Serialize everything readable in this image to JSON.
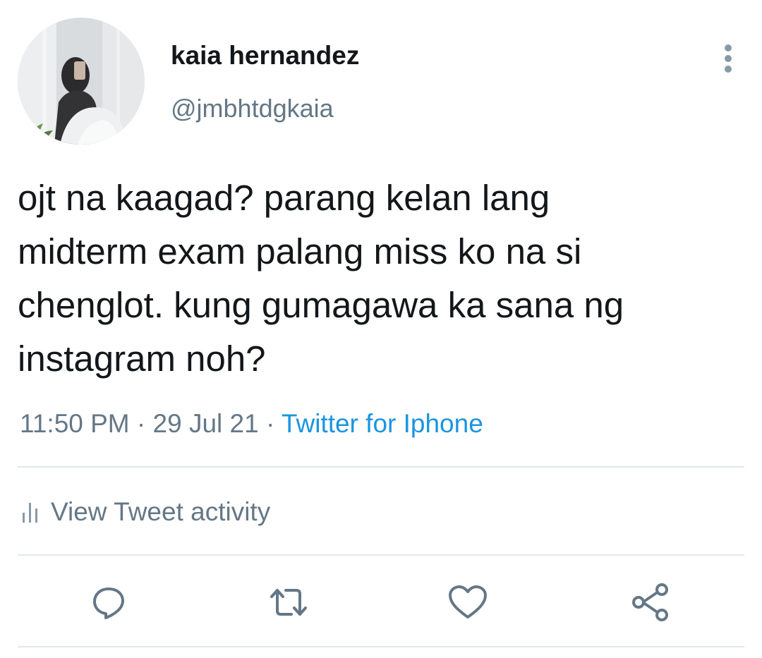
{
  "user": {
    "display_name": "kaia hernandez",
    "handle": "@jmbhtdgkaia",
    "avatar_icon": "profile-photo"
  },
  "tweet": {
    "text": "ojt na kaagad? parang kelan lang\nmidterm exam palang miss ko na si\nchenglot. kung gumagawa ka sana ng\ninstagram noh?",
    "time": "11:50 PM",
    "separator": "·",
    "date": "29 Jul 21",
    "source": "Twitter for Iphone"
  },
  "activity": {
    "label": "View Tweet activity",
    "icon": "bar-chart-icon"
  },
  "actions": [
    {
      "name": "reply",
      "icon": "reply-icon"
    },
    {
      "name": "retweet",
      "icon": "retweet-icon"
    },
    {
      "name": "like",
      "icon": "heart-icon"
    },
    {
      "name": "share",
      "icon": "share-icon"
    }
  ],
  "colors": {
    "text": "#14171a",
    "secondary": "#657786",
    "link": "#1b95e0",
    "icon": "#657786",
    "divider": "#e1e8ed"
  }
}
